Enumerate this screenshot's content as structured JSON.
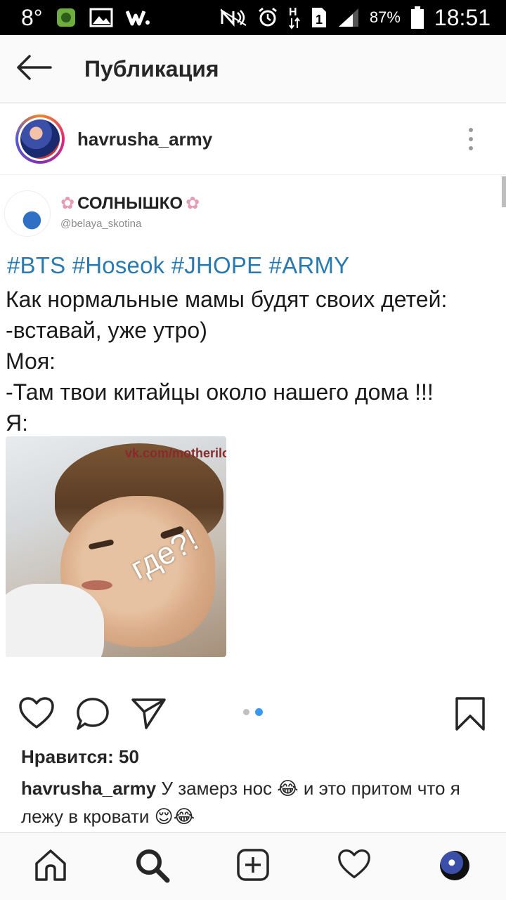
{
  "status_bar": {
    "temperature": "8°",
    "battery_percent": "87%",
    "time": "18:51",
    "sim_slot": "1",
    "network_type": "H",
    "icons": [
      "weather-icon",
      "image-icon",
      "w-app-icon",
      "nfc-icon",
      "alarm-icon",
      "sim-icon",
      "signal-icon",
      "battery-icon"
    ]
  },
  "header": {
    "title": "Публикация",
    "back_icon": "back-arrow-icon"
  },
  "post": {
    "username": "havrusha_army",
    "more_icon": "more-vertical-icon",
    "media": {
      "tweet_display_name": "СОЛНЫШКО",
      "tweet_handle": "@belaya_skotina",
      "hashtags": "#BTS #Hoseok #JHOPE #ARMY",
      "tweet_text": "Как нормальные мамы будят своих детей:\n-вставай, уже утро)\nМоя:\n-Там твои китайцы около нашего дома !!!\nЯ:",
      "meme_watermark": "vk.com/motherilovekorea",
      "meme_caption": "где?!"
    },
    "carousel": {
      "count": 2,
      "active_index": 1
    },
    "likes_text": "Нравится: 50",
    "caption_user": "havrusha_army",
    "caption_text": "У замерз нос 😂 и это притом что я лежу в кровати 😌😂"
  },
  "actions": [
    "heart-icon",
    "comment-icon",
    "share-icon",
    "bookmark-icon"
  ],
  "bottom_nav": [
    "home-icon",
    "search-icon",
    "add-post-icon",
    "activity-heart-icon",
    "profile-avatar"
  ],
  "colors": {
    "status_bar_bg": "#000000",
    "header_bg": "#fafafa",
    "hashtag_blue": "#2a7ab0",
    "carousel_active": "#3897f0",
    "text_primary": "#262626"
  }
}
